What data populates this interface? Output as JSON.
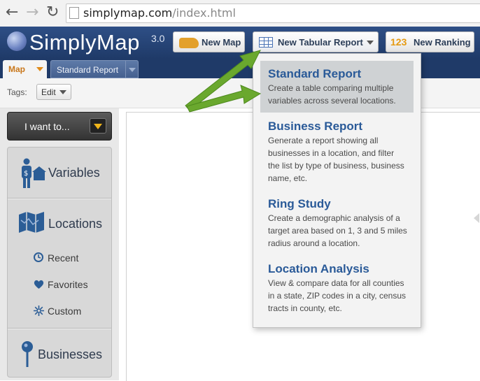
{
  "browser": {
    "url_host": "simplymap.com",
    "url_path": "/index.html"
  },
  "header": {
    "logo": "SimplyMap",
    "version": "3.0",
    "new_map": "New Map",
    "new_tabular_report": "New Tabular Report",
    "new_ranking_num": "123",
    "new_ranking": "New Ranking"
  },
  "tabs": [
    {
      "label": "Map"
    },
    {
      "label": "Standard Report"
    }
  ],
  "tags": {
    "label": "Tags:",
    "edit": "Edit"
  },
  "sidebar": {
    "i_want_to": "I want to...",
    "variables": "Variables",
    "locations": "Locations",
    "recent": "Recent",
    "favorites": "Favorites",
    "custom": "Custom",
    "businesses": "Businesses"
  },
  "dropdown": {
    "items": [
      {
        "title": "Standard Report",
        "desc": "Create a table comparing multiple variables across several locations."
      },
      {
        "title": "Business Report",
        "desc": "Generate a report showing all businesses in a location, and filter the list by type of business, business name, etc."
      },
      {
        "title": "Ring Study",
        "desc": "Create a demographic analysis of a target area based on 1, 3 and 5 miles radius around a location."
      },
      {
        "title": "Location Analysis",
        "desc": "View & compare data for all counties in a state, ZIP codes in a city, census tracts in county, etc."
      }
    ]
  },
  "colors": {
    "header_bg": "#1f3a68",
    "accent_orange": "#e08b1a",
    "link_blue": "#2a5a98",
    "arrow_green": "#6aa82e"
  }
}
